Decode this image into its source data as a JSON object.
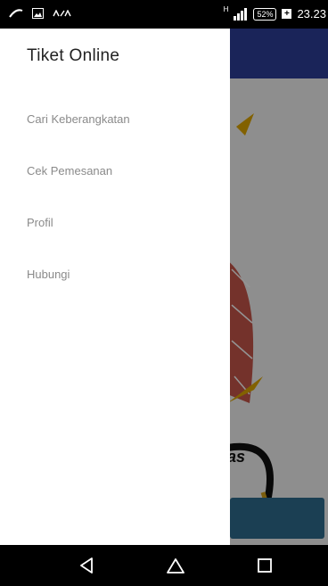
{
  "status_bar": {
    "battery_percent": "52%",
    "charging_symbol": "+",
    "network_type": "H",
    "time": "23.23",
    "icons": [
      "cellular-signal-icon",
      "image-notification-icon",
      "asus-logo-icon"
    ]
  },
  "drawer": {
    "title": "Tiket Online",
    "items": [
      {
        "label": "Cari Keberangkatan"
      },
      {
        "label": "Cek Pemesanan"
      },
      {
        "label": "Profil"
      },
      {
        "label": "Hubungi"
      }
    ]
  },
  "background_app": {
    "partial_text": "as"
  },
  "nav_bar": {
    "buttons": [
      "back-icon",
      "home-icon",
      "recents-icon"
    ]
  },
  "colors": {
    "toolbar": "#2d3f9a",
    "button": "#2f6d8f",
    "menu_text": "#8a8a8a",
    "title_text": "#222222"
  }
}
